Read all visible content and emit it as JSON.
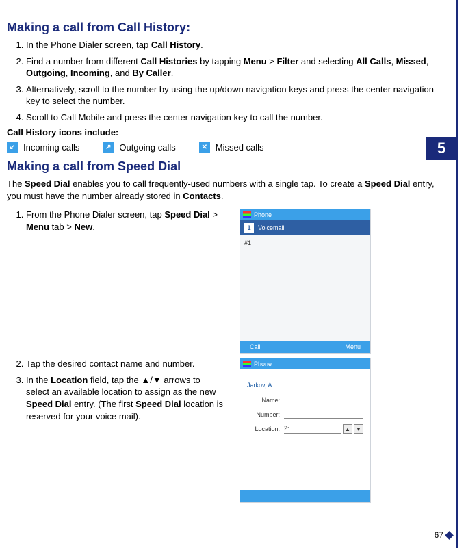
{
  "chapter_number": "5",
  "page_number": "67",
  "section1_title": "Making a call from Call History:",
  "s1_step1_a": "In the Phone Dialer screen, tap ",
  "s1_step1_b": "Call History",
  "s1_step1_c": ".",
  "s1_step2_a": "Find a number from different ",
  "s1_step2_b": "Call Histories",
  "s1_step2_c": " by tapping ",
  "s1_step2_d": "Menu",
  "s1_step2_e": " > ",
  "s1_step2_f": "Filter",
  "s1_step2_g": " and selecting ",
  "s1_step2_h": "All Calls",
  "s1_step2_i": ", ",
  "s1_step2_j": "Missed",
  "s1_step2_k": ", ",
  "s1_step2_l": "Outgoing",
  "s1_step2_m": ", ",
  "s1_step2_n": "Incoming",
  "s1_step2_o": ", and ",
  "s1_step2_p": "By Caller",
  "s1_step2_q": ".",
  "s1_step3": "Alternatively, scroll to the number by using the up/down navigation keys and press the center navigation key to select the number.",
  "s1_step4": "Scroll to Call Mobile and press the center navigation key to call the number.",
  "icons_intro_a": "Call History",
  "icons_intro_b": " icons include:",
  "icon_incoming_label": "Incoming calls",
  "icon_outgoing_label": "Outgoing calls",
  "icon_missed_label": "Missed calls",
  "section2_title": "Making a call from Speed Dial",
  "s2_intro_a": "The ",
  "s2_intro_b": "Speed Dial",
  "s2_intro_c": " enables you to call frequently-used numbers with a single tap. To create a ",
  "s2_intro_d": "Speed Dial",
  "s2_intro_e": " entry, you must have the number already stored in ",
  "s2_intro_f": "Contacts",
  "s2_intro_g": ".",
  "s2_step1_a": "From the Phone Dialer screen, tap ",
  "s2_step1_b": "Speed Dial",
  "s2_step1_c": " > ",
  "s2_step1_d": "Menu",
  "s2_step1_e": " tab > ",
  "s2_step1_f": "New",
  "s2_step1_g": ".",
  "s2_step2": "Tap the desired contact name and number.",
  "s2_step3_a": "In the ",
  "s2_step3_b": "Location",
  "s2_step3_c": " field, tap the ▲/▼ arrows to select an available location to assign as the new ",
  "s2_step3_d": "Speed Dial",
  "s2_step3_e": " entry. (The first ",
  "s2_step3_f": "Speed Dial",
  "s2_step3_g": " location is reserved for your voice mail).",
  "mock1": {
    "title": "Phone",
    "entry1_num": "1",
    "entry1_label": "Voicemail",
    "entry2_label": "#1",
    "soft_left": "Call",
    "soft_right": "Menu"
  },
  "mock2": {
    "title": "Phone",
    "contact": "Jarkov, A.",
    "lbl_name": "Name:",
    "lbl_number": "Number:",
    "lbl_location": "Location:",
    "val_location": "2:",
    "soft_left": "",
    "soft_right": ""
  }
}
